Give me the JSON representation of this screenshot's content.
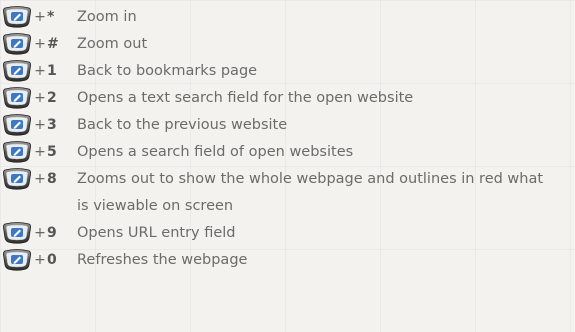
{
  "shortcuts": [
    {
      "plus": "+",
      "key": "*",
      "description": "Zoom in"
    },
    {
      "plus": "+",
      "key": "#",
      "description": "Zoom out"
    },
    {
      "plus": "+",
      "key": "1",
      "description": "Back to bookmarks page"
    },
    {
      "plus": "+",
      "key": "2",
      "description": "Opens a text search field for the open website"
    },
    {
      "plus": "+",
      "key": "3",
      "description": "Back to the previous website"
    },
    {
      "plus": "+",
      "key": "5",
      "description": "Opens a search field of open websites"
    },
    {
      "plus": "+",
      "key": "8",
      "description": "Zooms out to show the whole webpage and outlines in red what is viewable on screen"
    },
    {
      "plus": "+",
      "key": "9",
      "description": "Opens URL entry field"
    },
    {
      "plus": "+",
      "key": "0",
      "description": "Refreshes the webpage"
    }
  ],
  "icon": {
    "name": "phone-key-icon",
    "color": "#3b79c4"
  }
}
